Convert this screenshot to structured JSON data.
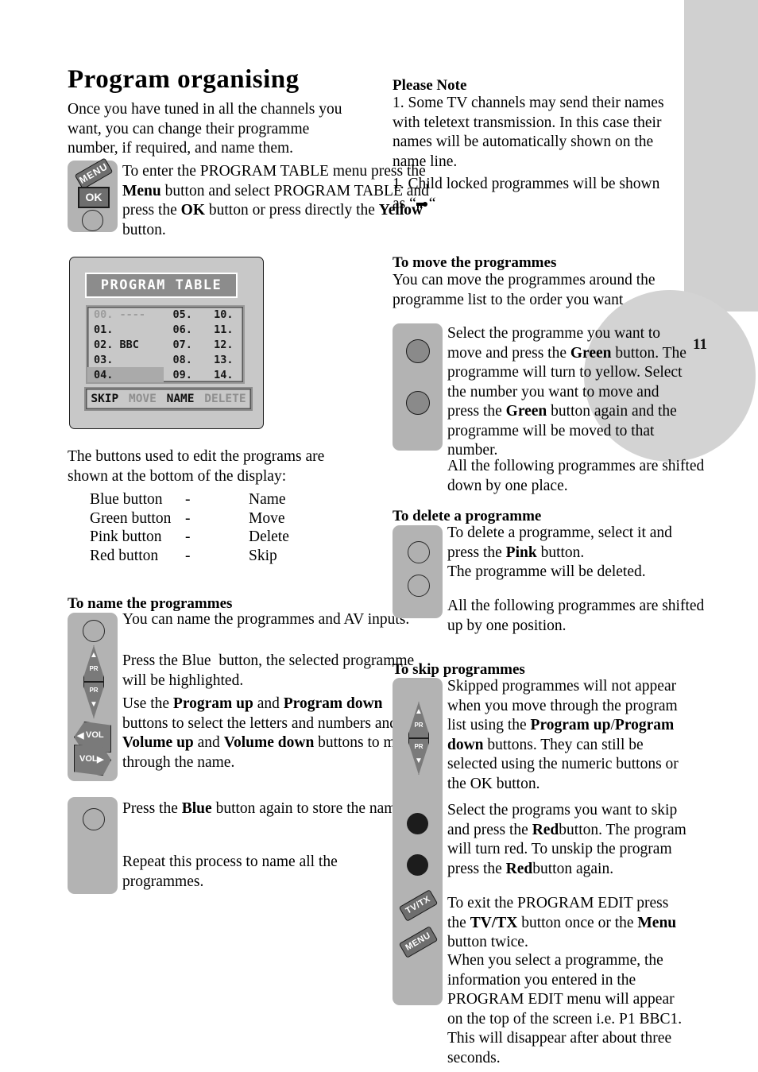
{
  "page": {
    "number": "11",
    "title": "Program organising"
  },
  "left": {
    "intro": "Once you have tuned in all the channels you want, you can change their programme number, if required, and name them.",
    "step1": {
      "keys": {
        "menu": "MENU",
        "ok": "OK",
        "yellow_button": "yellow-round-button"
      },
      "text_1": "To enter the PROGRAM TABLE menu press the ",
      "bold_1": "Menu",
      "text_2": " button and select PROGRAM TABLE and press the ",
      "bold_2": "OK",
      "text_3": " button or press directly the ",
      "bold_3": "Yellow",
      "text_4": " button."
    },
    "tv_screen": {
      "title": "PROGRAM TABLE",
      "rows": [
        [
          "00. ----",
          "05.",
          "10."
        ],
        [
          "01.",
          "06.",
          "11."
        ],
        [
          "02. BBC",
          "07.",
          "12."
        ],
        [
          "03.",
          "08.",
          "13."
        ],
        [
          "04.",
          "09.",
          "14."
        ]
      ],
      "dim_row_index": 0,
      "highlight_row_index": 4,
      "actions": [
        {
          "label": "SKIP",
          "state": "on"
        },
        {
          "label": "MOVE",
          "state": "off"
        },
        {
          "label": "NAME",
          "state": "on"
        },
        {
          "label": "DELETE",
          "state": "off"
        }
      ]
    },
    "legend_intro": "The buttons used to edit the programs are shown at the bottom of the display:",
    "legend": [
      {
        "button": "Blue button",
        "dash": "-",
        "action": "Name"
      },
      {
        "button": "Green button",
        "dash": "-",
        "action": "Move"
      },
      {
        "button": "Pink button",
        "dash": "-",
        "action": "Delete"
      },
      {
        "button": "Red button",
        "dash": "-",
        "action": "Skip"
      }
    ],
    "name_section": {
      "heading": "To name the programmes",
      "para1": "You can name the programmes and AV inputs.",
      "para2_a": "Press the",
      "para2_b": "Blue",
      "para2_c": " button, the selected programme will be highlighted.",
      "para3_a": "Use the",
      "para3_b": "Program up",
      "para3_c": " and ",
      "para3_d": "Program down",
      "para3_e": " buttons to select the letters and numbers and the ",
      "para3_f": "Volume up",
      "para3_g": " and ",
      "para3_h": "Volume down",
      "para3_i": " buttons to move through the name.",
      "keys": {
        "pr_up": "PR",
        "pr_down": "PR",
        "vol_down": "VOL",
        "vol_up": "VOL"
      }
    },
    "store_section": {
      "para1_a": "Press the ",
      "para1_b": "Blue",
      "para1_c": " button again to store the name.",
      "para2": "Repeat this process to name all the programmes."
    }
  },
  "right": {
    "please_note": {
      "heading": "Please Note",
      "item1": "1. Some TV channels may send their names with teletext transmission. In this case their names will be automatically shown on the name line.",
      "item2_a": "1. Child locked programmes will be shown as “",
      "item2_icon": "key-icon",
      "item2_b": "“"
    },
    "move_section": {
      "heading": "To move the programmes",
      "intro": "You can move the programmes around the programme list to the order you want",
      "para_a": "Select the programme you want to move and press the ",
      "para_b": "Green",
      "para_c": " button. The programme will turn to yellow. Select the number you want to move and press the ",
      "para_d": "Green",
      "para_e": " button again and the programme will be moved to that number.",
      "para2": "All the following programmes are shifted down by one place."
    },
    "delete_section": {
      "heading": "To delete a programme",
      "para_a": "To delete a programme, select it and press the ",
      "para_b": "Pink",
      "para_c": " button.",
      "para2": "The programme will be deleted.",
      "para3": "All the following programmes are shifted up by one position."
    },
    "skip_section": {
      "heading": "To skip programmes",
      "para1_a": "Skipped programmes will not appear when you move through the program list using the ",
      "para1_b": "Program up",
      "para1_c": "/",
      "para1_d": "Program down",
      "para1_e": " buttons.",
      "para1_f": "They can still be selected using the numeric buttons or the OK button.",
      "para2_a": "Select the programs you want to skip and press the ",
      "para2_b": "Red",
      "para2_c": "button. The program will turn red.  To unskip the program press the ",
      "para2_d": "Red",
      "para2_e": "button again.",
      "para3_a": "To exit the PROGRAM EDIT press the  ",
      "para3_b": "TV/TX",
      "para3_c": "  button once or the ",
      "para3_d": "Menu",
      "para3_e": "  button twice.",
      "para4": "When you select a programme, the information you entered in the PROGRAM EDIT menu will appear on the top of the screen i.e. P1 BBC1. This will disappear after about three seconds.",
      "keys": {
        "pr_up": "PR",
        "pr_down": "PR",
        "tvtx": "TV/TX",
        "menu": "MENU"
      }
    }
  }
}
